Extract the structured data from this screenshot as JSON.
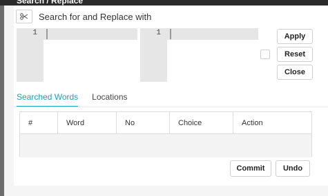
{
  "window": {
    "title": "Search / Replace"
  },
  "header": {
    "title": "Search for and Replace with",
    "icon": "scissors-icon"
  },
  "search_editor": {
    "line_number": "1"
  },
  "replace_editor": {
    "line_number": "1"
  },
  "buttons": {
    "apply": "Apply",
    "reset": "Reset",
    "close": "Close",
    "commit": "Commit",
    "undo": "Undo"
  },
  "tabs": [
    {
      "label": "Searched Words",
      "active": true
    },
    {
      "label": "Locations",
      "active": false
    }
  ],
  "table": {
    "columns": [
      "#",
      "Word",
      "No",
      "Choice",
      "Action"
    ],
    "rows": []
  },
  "colors": {
    "accent": "#1aa0b8",
    "titlebar": "#2b2b2b"
  }
}
